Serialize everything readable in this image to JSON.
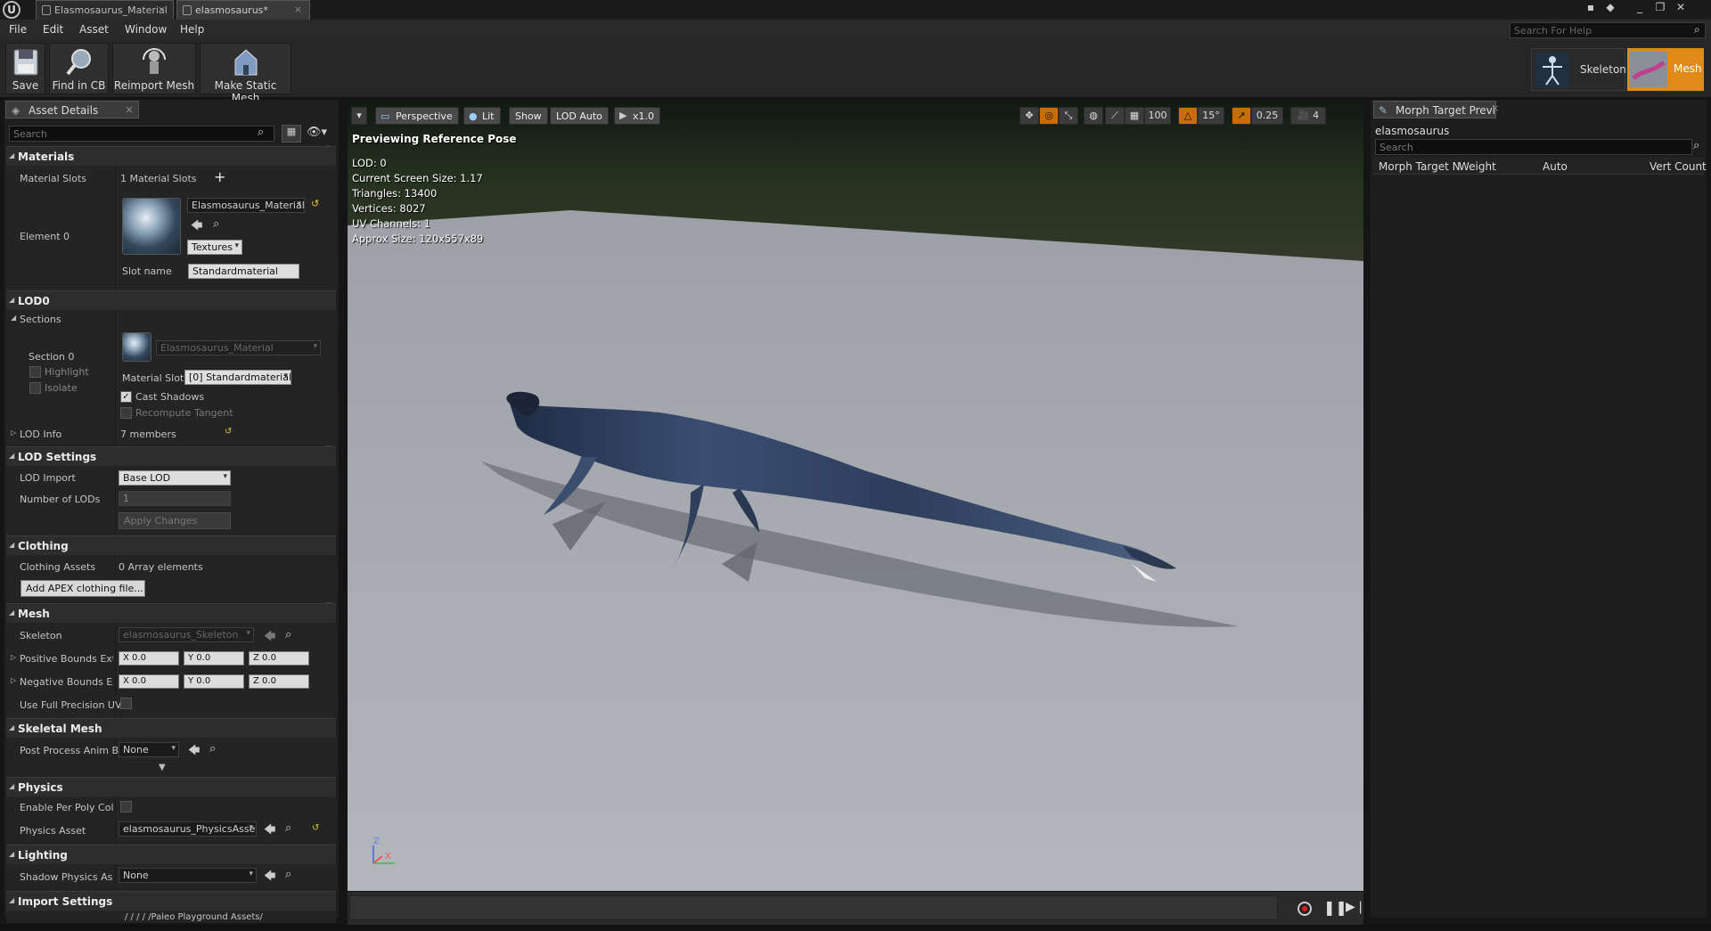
{
  "window": {
    "tabs": [
      {
        "label": "Elasmosaurus_Material"
      },
      {
        "label": "elasmosaurus*"
      }
    ],
    "logo": "U"
  },
  "menu": {
    "items": [
      "File",
      "Edit",
      "Asset",
      "Window",
      "Help"
    ],
    "help_search_placeholder": "Search For Help"
  },
  "toolbar": {
    "save": "Save",
    "find_in_cb": "Find in CB",
    "reimport": "Reimport Mesh",
    "make_static": "Make Static Mesh",
    "mode_skeleton": "Skeleton",
    "mode_mesh": "Mesh"
  },
  "left_panel": {
    "tab_title": "Asset Details",
    "search_placeholder": "Search",
    "materials": {
      "header": "Materials",
      "slots_label": "Material Slots",
      "slots_value": "1 Material Slots",
      "element_label": "Element 0",
      "material_name": "Elasmosaurus_Material",
      "textures_label": "Textures",
      "slot_name_label": "Slot name",
      "slot_name_value": "Standardmaterial"
    },
    "lod0": {
      "header": "LOD0",
      "sections_label": "Sections",
      "section_label": "Section 0",
      "highlight_label": "Highlight",
      "isolate_label": "Isolate",
      "material_name": "Elasmosaurus_Material",
      "material_slot_label": "Material Slot",
      "material_slot_value": "[0] Standardmaterial",
      "cast_shadows_label": "Cast Shadows",
      "recompute_label": "Recompute Tangent",
      "lod_info_label": "LOD Info",
      "lod_info_value": "7 members"
    },
    "lod_settings": {
      "header": "LOD Settings",
      "lod_import_label": "LOD Import",
      "lod_import_value": "Base LOD",
      "num_lods_label": "Number of LODs",
      "num_lods_value": "1",
      "apply_label": "Apply Changes"
    },
    "clothing": {
      "header": "Clothing",
      "assets_label": "Clothing Assets",
      "assets_value": "0 Array elements",
      "add_button": "Add APEX clothing file..."
    },
    "mesh": {
      "header": "Mesh",
      "skeleton_label": "Skeleton",
      "skeleton_value": "elasmosaurus_Skeleton",
      "pos_bounds_label": "Positive Bounds Exte",
      "neg_bounds_label": "Negative Bounds Exte",
      "pos_x": "X 0.0",
      "pos_y": "Y 0.0",
      "pos_z": "Z 0.0",
      "neg_x": "X 0.0",
      "neg_y": "Y 0.0",
      "neg_z": "Z 0.0",
      "full_precision_label": "Use Full Precision UV"
    },
    "skeletal_mesh": {
      "header": "Skeletal Mesh",
      "post_process_label": "Post Process Anim B",
      "post_process_value": "None"
    },
    "physics": {
      "header": "Physics",
      "per_poly_label": "Enable Per Poly Collis",
      "asset_label": "Physics Asset",
      "asset_value": "elasmosaurus_PhysicsAsset"
    },
    "lighting": {
      "header": "Lighting",
      "shadow_label": "Shadow Physics Asse",
      "shadow_value": "None"
    },
    "import_settings": {
      "header": "Import Settings",
      "path": "/ / / / /Paleo Playground Assets/"
    }
  },
  "viewport": {
    "perspective": "Perspective",
    "lit": "Lit",
    "show": "Show",
    "lod_auto": "LOD Auto",
    "play_speed": "x1.0",
    "grid_size": "100",
    "rot_snap": "15°",
    "scale_snap": "0.25",
    "cam_speed": "4",
    "preview_title": "Previewing Reference Pose",
    "stats": [
      "LOD: 0",
      "Current Screen Size: 1.17",
      "Triangles: 13400",
      "Vertices: 8027",
      "UV Channels: 1",
      "Approx Size: 120x557x89"
    ],
    "axis_z": "Z",
    "axis_x": "X"
  },
  "right_panel": {
    "tab_title": "Morph Target Previ",
    "asset_name": "elasmosaurus",
    "search_placeholder": "Search",
    "columns": [
      "Morph Target N",
      "Weight",
      "Auto",
      "Vert Count"
    ]
  },
  "colors": {
    "accent_orange": "#c86d00",
    "panel_bg": "#1f1f1f",
    "header_bg": "#2d2d2d"
  }
}
